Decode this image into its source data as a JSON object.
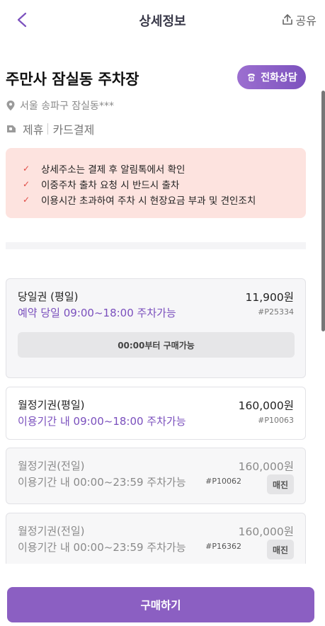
{
  "header": {
    "title": "상세정보",
    "share_label": "공유"
  },
  "parking": {
    "name": "주만사 잠실동 주차장",
    "call_label": "전화상담",
    "address": "서울 송파구 잠실동***",
    "tags": [
      "제휴",
      "카드결제"
    ]
  },
  "notices": [
    "상세주소는 결제 후 알림톡에서 확인",
    "이중주차 출차 요청 시 반드시 출차",
    "이용시간 초과하여 주차 시 현장요금 부과 및 견인조치"
  ],
  "tickets": [
    {
      "name": "당일권 (평일)",
      "price": "11,900원",
      "sub": "예약 당일 09:00~18:00 주차가능",
      "code": "#P25334",
      "action": "00:00부터 구매가능"
    },
    {
      "name": "월정기권(평일)",
      "price": "160,000원",
      "sub": "이용기간 내 09:00~18:00 주차가능",
      "code": "#P10063"
    },
    {
      "name": "월정기권(전일)",
      "price": "160,000원",
      "sub": "이용기간 내 00:00~23:59 주차가능",
      "code": "#P10062",
      "badge": "매진"
    },
    {
      "name": "월정기권(전일)",
      "price": "160,000원",
      "sub": "이용기간 내 00:00~23:59 주차가능",
      "code": "#P16362",
      "badge": "매진"
    }
  ],
  "footer": {
    "buy_label": "구매하기"
  },
  "colors": {
    "accent": "#8b5fc2",
    "notice_bg": "#fde3df",
    "check": "#e04a44"
  }
}
